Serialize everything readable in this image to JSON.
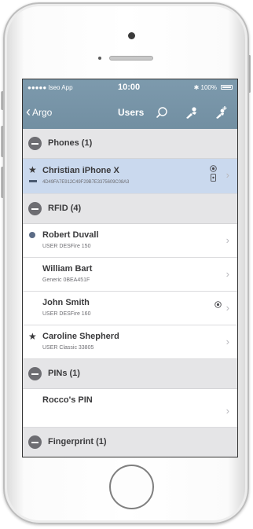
{
  "status_bar": {
    "carrier": "●●●●● Iseo App",
    "time": "10:00",
    "battery": "✱ 100%"
  },
  "nav": {
    "back_label": "Argo",
    "title": "Users"
  },
  "sections": {
    "phones": {
      "title": "Phones (1)",
      "rows": [
        {
          "title": "Christian iPhone X",
          "subtitle": "4D49FA7E912C49F29B7E3375609C08A3"
        }
      ]
    },
    "rfid": {
      "title": "RFID (4)",
      "rows": [
        {
          "title": "Robert Duvall",
          "subtitle": "USER DESFire 150"
        },
        {
          "title": "William Bart",
          "subtitle": "Generic 0BEA451F"
        },
        {
          "title": "John Smith",
          "subtitle": "USER DESFire 160"
        },
        {
          "title": "Caroline Shepherd",
          "subtitle": "USER Classic 33805"
        }
      ]
    },
    "pins": {
      "title": "PINs (1)",
      "rows": [
        {
          "title": "Rocco's PIN",
          "subtitle": ""
        }
      ]
    },
    "fingerprint": {
      "title": "Fingerprint (1)"
    }
  },
  "icons": {
    "back": "chevron-left-icon",
    "search": "search-icon",
    "user": "user-icon",
    "add_user": "add-user-icon",
    "section": "minus-circle-icon",
    "favorite": "star-icon",
    "row": "chevron-right-icon"
  },
  "colors": {
    "header": "#728fa2",
    "selected_row": "#cad9ee",
    "section_bg": "#e5e5e7"
  }
}
